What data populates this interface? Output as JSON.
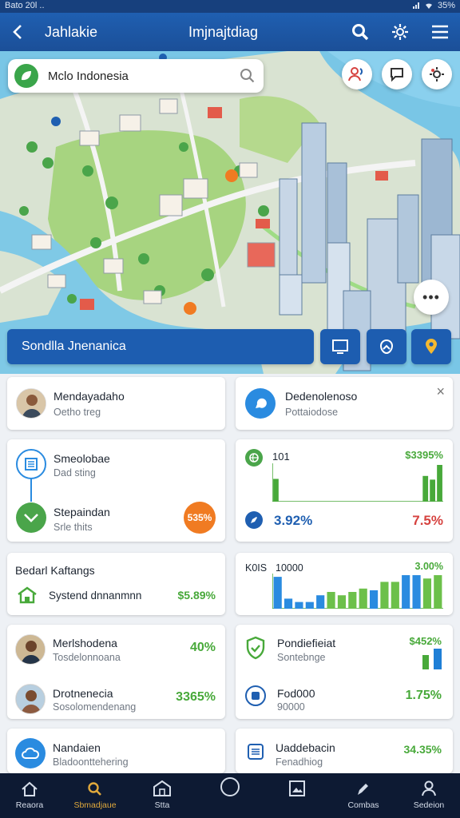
{
  "status": {
    "time": "Bato 20l ..",
    "battery": "35%"
  },
  "header": {
    "title": "Jahlakie",
    "center_title": "Imjnajtdiag"
  },
  "search": {
    "value": "Mclo Indonesia",
    "placeholder": ""
  },
  "banner": {
    "label": "Sondlla Jnenanica"
  },
  "more_label": "•••",
  "cards": {
    "profile": {
      "title": "Mendayadaho",
      "sub": "Oetho treg"
    },
    "info": {
      "title": "Dedenolenoso",
      "sub": "Pottaiodose",
      "close": "×"
    },
    "steps": {
      "item1": {
        "title": "Smeolobae",
        "sub": "Dad sting"
      },
      "item2": {
        "title": "Stepaindan",
        "sub": "Srle thits",
        "badge": "535%"
      }
    },
    "chart1": {
      "label": "101",
      "value_top": "$3395%",
      "value_left": "3.92%",
      "value_right": "7.5%"
    },
    "bedarl": {
      "title": "Bedarl Kaftangs",
      "row_label": "Systend dnnanmnn",
      "row_value": "$5.89%"
    },
    "chart2": {
      "label_left": "K0IS",
      "label_mid": "10000",
      "value_top": "3.00%"
    },
    "people": {
      "p1": {
        "title": "Merlshodena",
        "sub": "Tosdelonnoana",
        "value": "40%"
      },
      "p2": {
        "title": "Drotnenecia",
        "sub": "Sosolomendenang",
        "value": "3365%"
      }
    },
    "stats": {
      "s1": {
        "title": "Pondiefieiat",
        "sub": "Sontebnge",
        "value": "$452%"
      },
      "s2": {
        "title": "Fod000",
        "sub": "90000",
        "value": "1.75%"
      }
    },
    "bottom_left": {
      "title": "Nandaien",
      "sub": "Bladoonttehering"
    },
    "bottom_right": {
      "title": "Uaddebacin",
      "sub": "Fenadhiog",
      "value": "34.35%"
    }
  },
  "chart_data": [
    {
      "type": "bar",
      "values": [
        62,
        8,
        8,
        8,
        8,
        8,
        8,
        8,
        8,
        8,
        8,
        8,
        8,
        8,
        8,
        8,
        8,
        8,
        8,
        8,
        8,
        70,
        60,
        100
      ],
      "ylim": [
        0,
        100
      ]
    },
    {
      "type": "bar",
      "series": [
        {
          "colors": "blue",
          "values": [
            95,
            30,
            20,
            20,
            40,
            50,
            40,
            50,
            60,
            55,
            80,
            80,
            100,
            100,
            90,
            100
          ]
        }
      ],
      "ylim": [
        0,
        100
      ]
    }
  ],
  "nav": [
    {
      "label": "Reaora",
      "icon": "home-icon"
    },
    {
      "label": "Sbmadjaue",
      "icon": "search-icon"
    },
    {
      "label": "Stta",
      "icon": "building-icon"
    },
    {
      "label": "",
      "icon": "circle-icon"
    },
    {
      "label": "",
      "icon": "photo-icon"
    },
    {
      "label": "Combas",
      "icon": "pen-icon"
    },
    {
      "label": "Sedeion",
      "icon": "user-icon"
    }
  ],
  "colors": {
    "primary": "#1f5fb1",
    "green": "#48a93a",
    "red": "#d6423f",
    "orange": "#f07b22"
  }
}
